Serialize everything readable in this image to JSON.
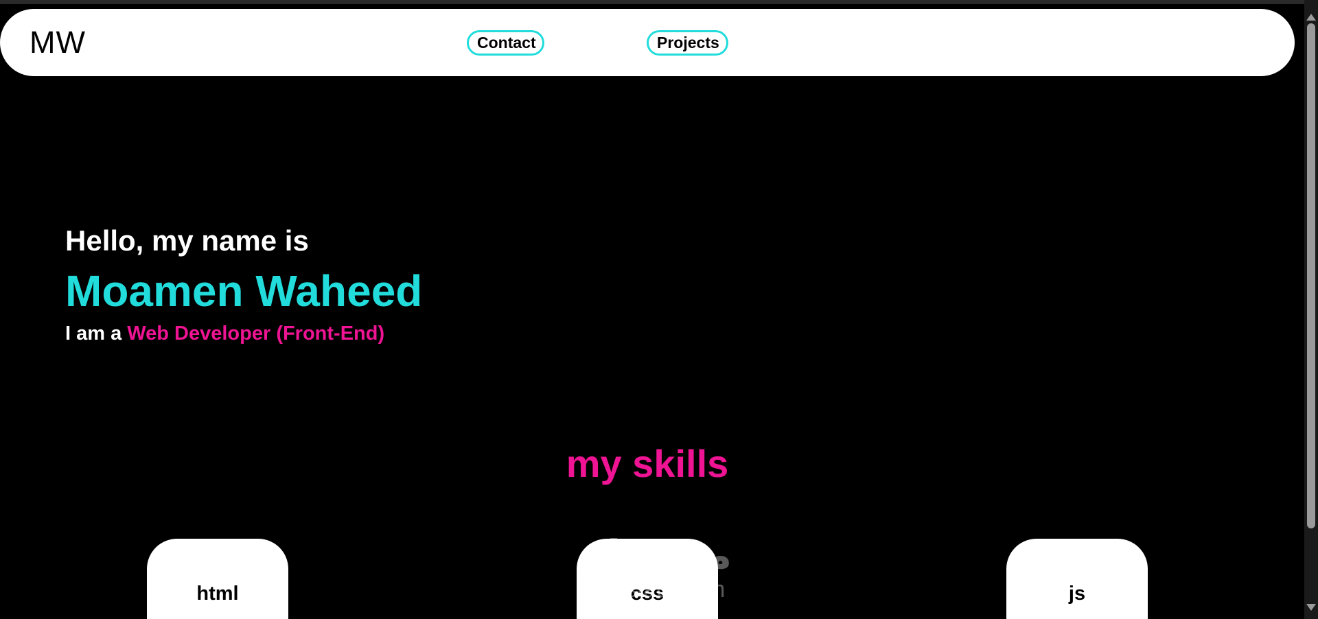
{
  "header": {
    "logo": "MW",
    "nav": [
      {
        "label": "Contact"
      },
      {
        "label": "Projects"
      }
    ]
  },
  "hero": {
    "greeting": "Hello, my name is",
    "name": "Moamen Waheed",
    "role_prefix": "I am a",
    "role_title": "Web Developer (Front-End)"
  },
  "skills": {
    "title": "my skills",
    "items": [
      {
        "label": "html"
      },
      {
        "label": "css"
      },
      {
        "label": "js"
      }
    ]
  },
  "watermark": {
    "text": "mostaql.com",
    "arabic": "مستقل"
  },
  "colors": {
    "accent_cyan": "#22dcdc",
    "accent_pink": "#ee1493",
    "background": "#000000",
    "surface": "#ffffff"
  }
}
